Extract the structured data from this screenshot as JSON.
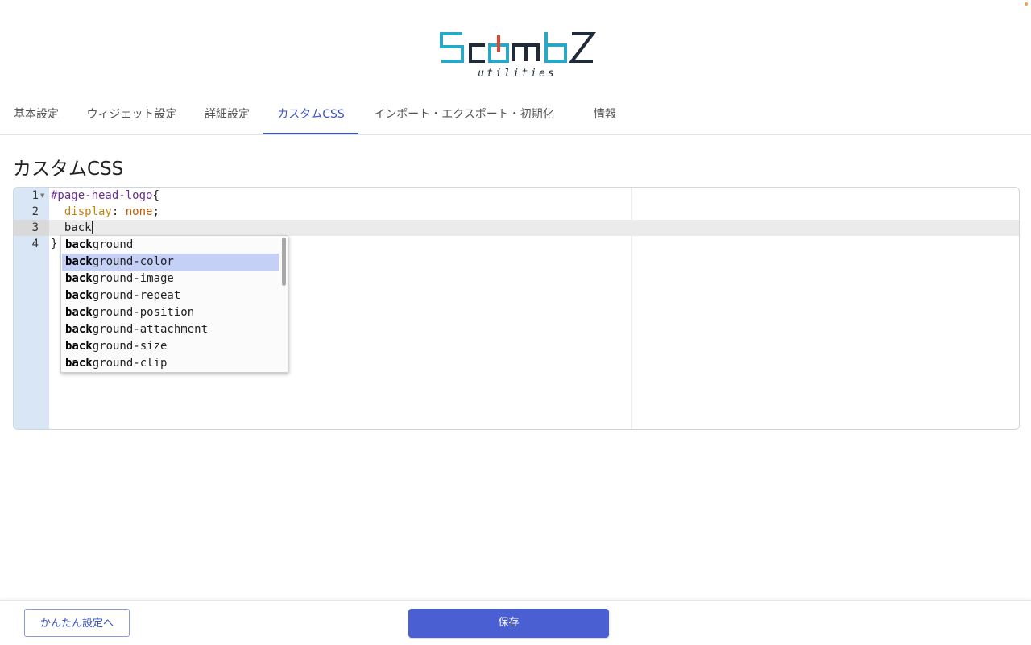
{
  "header": {
    "logo_subtitle": "utilities",
    "logo_text": "ScombZ"
  },
  "tabs": [
    {
      "label": "基本設定"
    },
    {
      "label": "ウィジェット設定"
    },
    {
      "label": "詳細設定"
    },
    {
      "label": "カスタムCSS"
    },
    {
      "label": "インポート・エクスポート・初期化"
    },
    {
      "label": "情報"
    }
  ],
  "active_tab": "カスタムCSS",
  "main": {
    "title": "カスタムCSS"
  },
  "editor": {
    "line_numbers": [
      "1",
      "2",
      "3",
      "4"
    ],
    "active_line": 3,
    "lines": {
      "l1_selector": "#page-head-logo",
      "l1_brace": "{",
      "l2_indent": "  ",
      "l2_prop": "display",
      "l2_colon": ": ",
      "l2_value": "none",
      "l2_semi": ";",
      "l3_text": "  back",
      "l4_text": "}"
    },
    "autocomplete": {
      "typed_prefix": "back",
      "selected_index": 1,
      "items": [
        {
          "match": "back",
          "rest": "ground"
        },
        {
          "match": "back",
          "rest": "ground-color"
        },
        {
          "match": "back",
          "rest": "ground-image"
        },
        {
          "match": "back",
          "rest": "ground-repeat"
        },
        {
          "match": "back",
          "rest": "ground-position"
        },
        {
          "match": "back",
          "rest": "ground-attachment"
        },
        {
          "match": "back",
          "rest": "ground-size"
        },
        {
          "match": "back",
          "rest": "ground-clip"
        }
      ]
    }
  },
  "footer": {
    "simple_settings_label": "かんたん設定へ",
    "save_label": "保存"
  },
  "colors": {
    "accent": "#3b55c5",
    "save_button": "#4a5fd1",
    "gutter": "#d8e6f5",
    "selection": "#c5d0f7"
  }
}
